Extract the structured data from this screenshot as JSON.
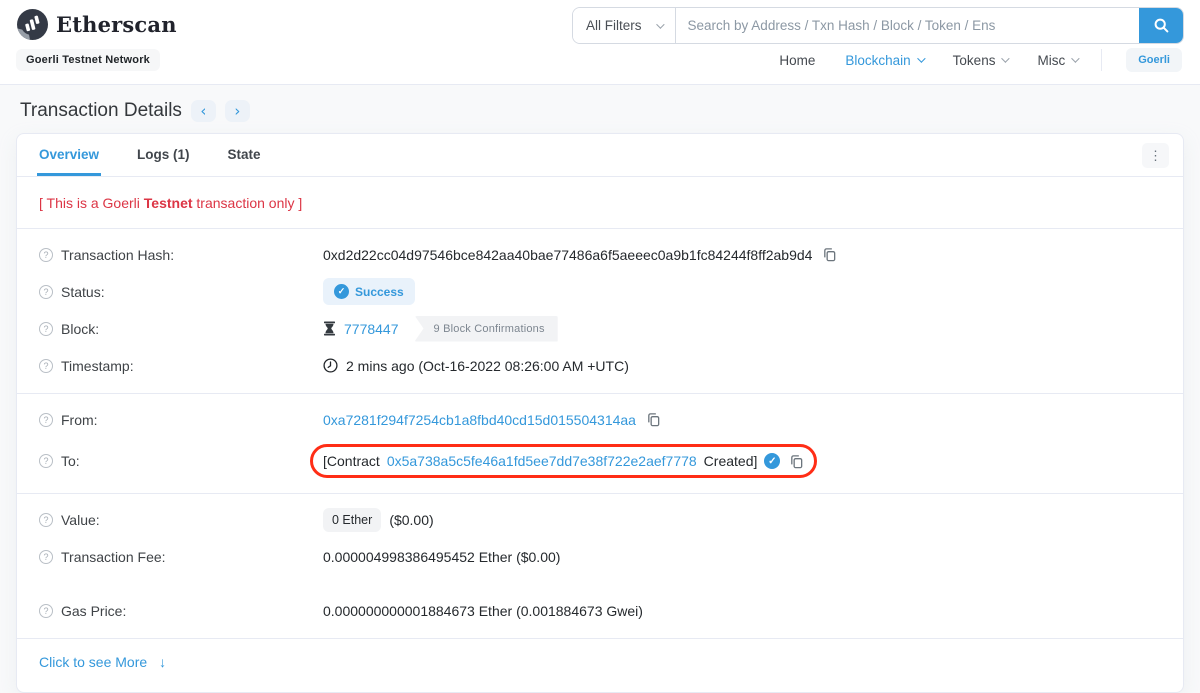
{
  "header": {
    "brand": "Etherscan",
    "network_badge": "Goerli Testnet Network",
    "search": {
      "filter_label": "All Filters",
      "placeholder": "Search by Address / Txn Hash / Block / Token / Ens"
    },
    "nav": [
      {
        "label": "Home",
        "active": false,
        "dropdown": false
      },
      {
        "label": "Blockchain",
        "active": true,
        "dropdown": true
      },
      {
        "label": "Tokens",
        "active": false,
        "dropdown": true
      },
      {
        "label": "Misc",
        "active": false,
        "dropdown": true
      }
    ],
    "network_button": "Goerli"
  },
  "page": {
    "title": "Transaction Details"
  },
  "tabs": [
    {
      "label": "Overview",
      "active": true
    },
    {
      "label": "Logs (1)",
      "active": false
    },
    {
      "label": "State",
      "active": false
    }
  ],
  "notice": {
    "prefix": "[ This is a Goerli ",
    "bold": "Testnet",
    "suffix": " transaction only ]"
  },
  "rows": {
    "transaction_hash": {
      "label": "Transaction Hash:",
      "value": "0xd2d22cc04d97546bce842aa40bae77486a6f5aeeec0a9b1fc84244f8ff2ab9d4"
    },
    "status": {
      "label": "Status:",
      "value": "Success"
    },
    "block": {
      "label": "Block:",
      "number": "7778447",
      "confirmations": "9 Block Confirmations"
    },
    "timestamp": {
      "label": "Timestamp:",
      "value": "2 mins ago (Oct-16-2022 08:26:00 AM +UTC)"
    },
    "from": {
      "label": "From:",
      "address": "0xa7281f294f7254cb1a8fbd40cd15d015504314aa"
    },
    "to": {
      "label": "To:",
      "prefix": "[Contract",
      "address": "0x5a738a5c5fe46a1fd5ee7dd7e38f722e2aef7778",
      "suffix": "Created]"
    },
    "value": {
      "label": "Value:",
      "badge": "0 Ether",
      "usd": "($0.00)"
    },
    "transaction_fee": {
      "label": "Transaction Fee:",
      "value": "0.000004998386495452 Ether ($0.00)"
    },
    "gas_price": {
      "label": "Gas Price:",
      "value": "0.000000000001884673 Ether (0.001884673 Gwei)"
    }
  },
  "footer_link": {
    "label": "Click to see More"
  },
  "icons": {
    "question_glyph": "?",
    "check_glyph": "✓",
    "kebab_glyph": "⋮",
    "more_arrow_glyph": "↓",
    "prev_glyph": "‹",
    "next_glyph": "›"
  },
  "colors": {
    "accent": "#3498db",
    "danger": "#dc3545",
    "annotation": "#ff2d16",
    "brand_dark": "#343a46"
  }
}
